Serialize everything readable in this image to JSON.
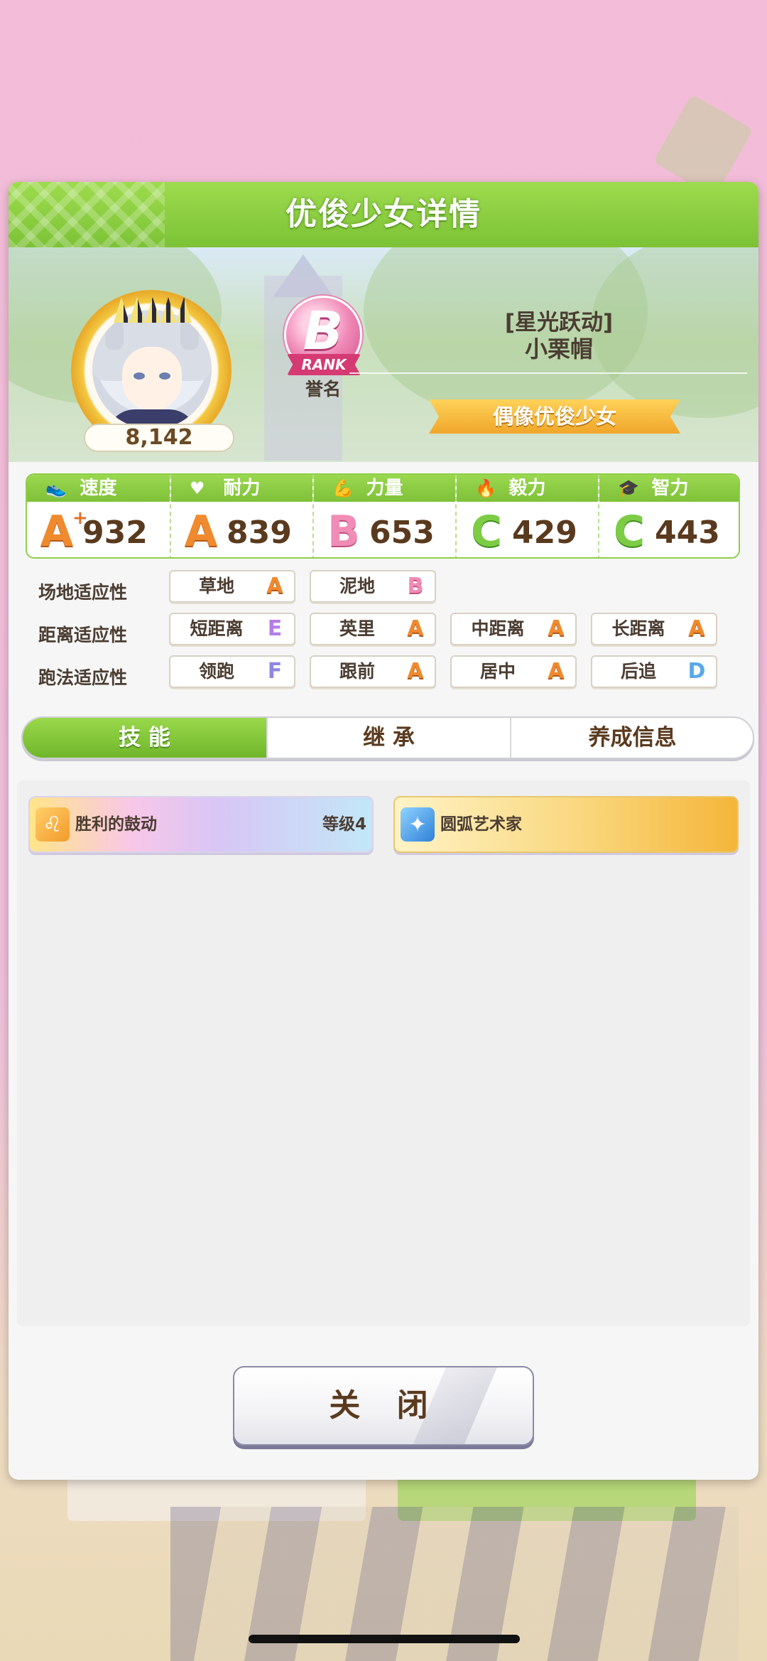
{
  "panel": {
    "title": "优俊少女详情"
  },
  "character": {
    "score": "8,142",
    "rank_letter": "B",
    "rank_ribbon": "RANK",
    "rank_caption": "誉名",
    "title": "[星光跃动]",
    "name": "小栗帽",
    "class": "偶像优俊少女"
  },
  "stats": [
    {
      "icon": "shoe-icon",
      "glyph": "👟",
      "label": "速度",
      "grade": "A",
      "plus": "+",
      "value": "932",
      "color": "#f08a2e"
    },
    {
      "icon": "heart-icon",
      "glyph": "♥",
      "label": "耐力",
      "grade": "A",
      "plus": "",
      "value": "839",
      "color": "#f08a2e"
    },
    {
      "icon": "muscle-icon",
      "glyph": "💪",
      "label": "力量",
      "grade": "B",
      "plus": "",
      "value": "653",
      "color": "#f08cb5"
    },
    {
      "icon": "flame-icon",
      "glyph": "🔥",
      "label": "毅力",
      "grade": "C",
      "plus": "",
      "value": "429",
      "color": "#7ccc45"
    },
    {
      "icon": "grad-cap-icon",
      "glyph": "🎓",
      "label": "智力",
      "grade": "C",
      "plus": "",
      "value": "443",
      "color": "#7ccc45"
    }
  ],
  "aptitude": {
    "track": {
      "label": "场地适应性",
      "items": [
        {
          "name": "草地",
          "grade": "A"
        },
        {
          "name": "泥地",
          "grade": "B"
        }
      ]
    },
    "distance": {
      "label": "距离适应性",
      "items": [
        {
          "name": "短距离",
          "grade": "E"
        },
        {
          "name": "英里",
          "grade": "A"
        },
        {
          "name": "中距离",
          "grade": "A"
        },
        {
          "name": "长距离",
          "grade": "A"
        }
      ]
    },
    "strategy": {
      "label": "跑法适应性",
      "items": [
        {
          "name": "领跑",
          "grade": "F"
        },
        {
          "name": "跟前",
          "grade": "A"
        },
        {
          "name": "居中",
          "grade": "A"
        },
        {
          "name": "后追",
          "grade": "D"
        }
      ]
    }
  },
  "tabs": [
    {
      "label": "技 能",
      "active": true
    },
    {
      "label": "继 承",
      "active": false
    },
    {
      "label": "养成信息",
      "active": false
    }
  ],
  "skills": [
    {
      "name": "胜利的鼓动",
      "level": "等级4",
      "icon": "lion-icon"
    },
    {
      "name": "圆弧艺术家",
      "level": "",
      "icon": "sparkle-icon"
    }
  ],
  "close_label": "关 闭"
}
